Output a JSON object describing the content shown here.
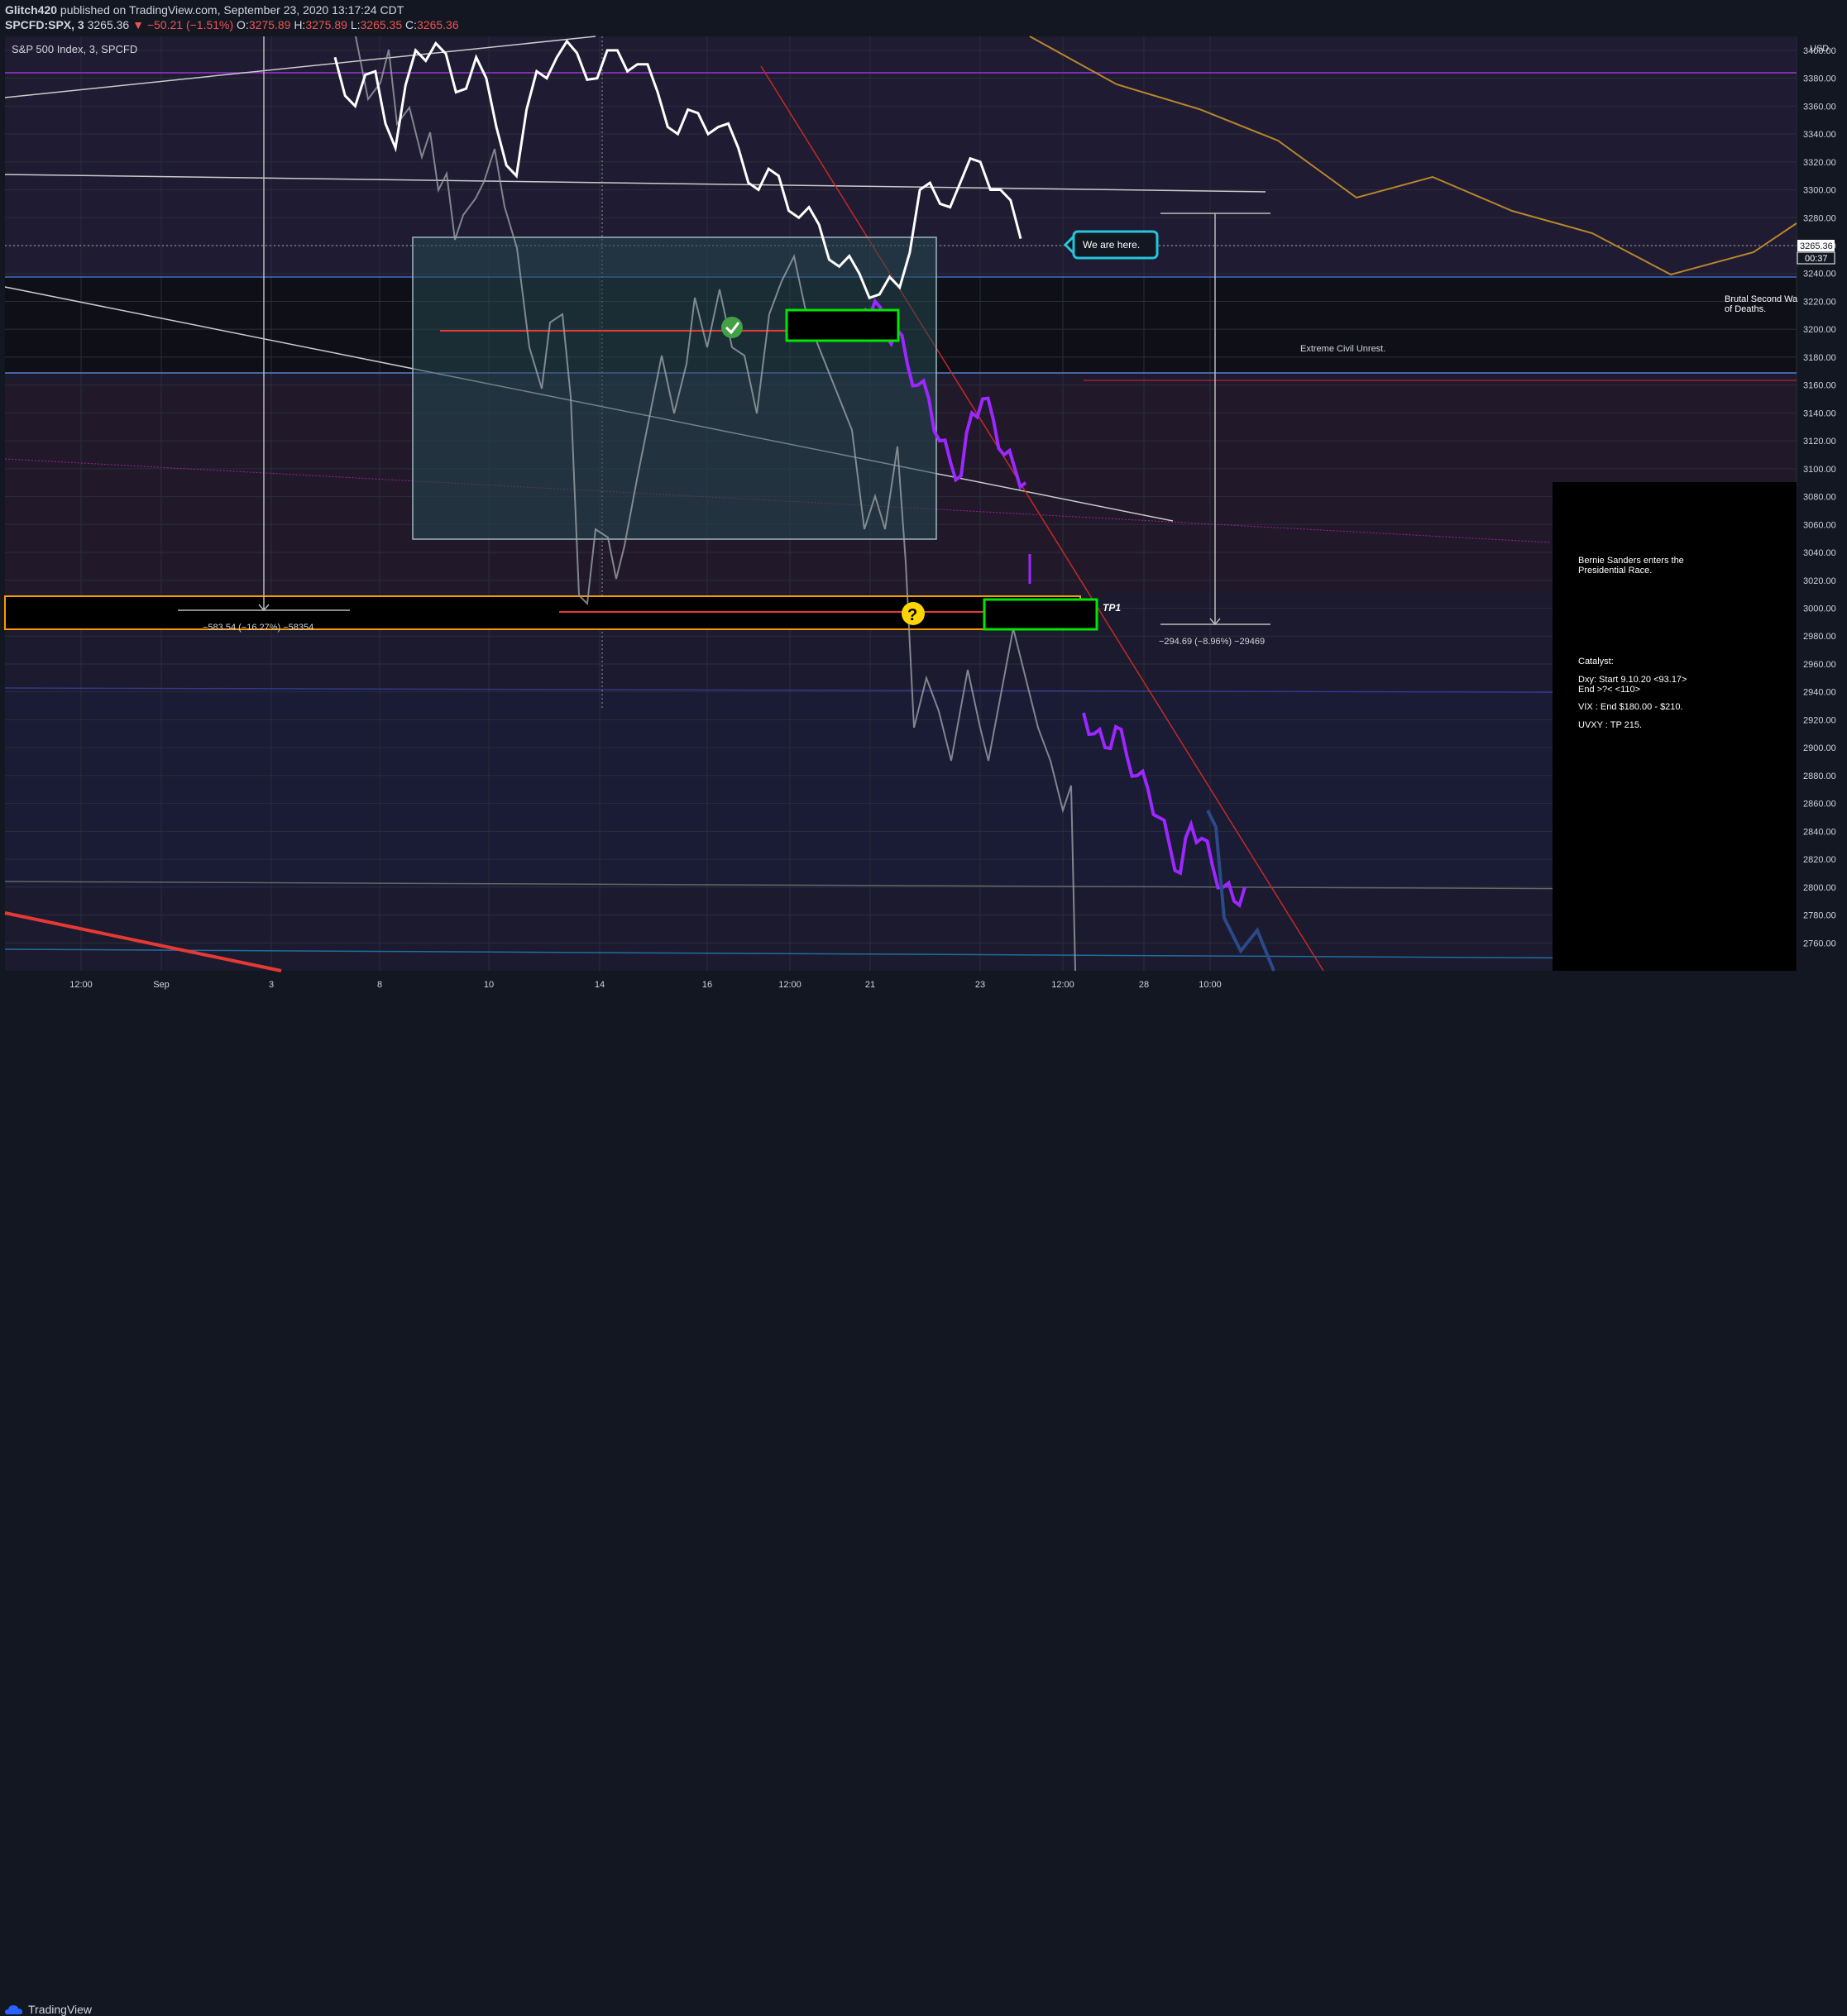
{
  "header": {
    "author": "Glitch420",
    "published": "published on TradingView.com, September 23, 2020 13:17:24 CDT",
    "symbol": "SPCFD:SPX, 3",
    "last": "3265.36",
    "change": "−50.21 (−1.51%)",
    "o_label": "O:",
    "o": "3275.89",
    "h_label": "H:",
    "h": "3275.89",
    "l_label": "L:",
    "l": "3265.35",
    "c_label": "C:",
    "c": "3265.36"
  },
  "pane": {
    "title": "S&P 500 Index, 3, SPCFD",
    "currency": "USD",
    "price_tag": "3265.36",
    "time_tag": "00:37"
  },
  "annotations": {
    "we_are_here": "We are here.",
    "brutal": "Brutal Second Wave of Deaths.",
    "civil_unrest": "Extreme Civil Unrest.",
    "measure_left": "−583.54 (−16.27%) −58354",
    "measure_right": "−294.69 (−8.96%) −29469",
    "tp1": "TP1",
    "question": "?",
    "note_bernie": "Bernie Sanders enters the Presidential Race.",
    "note_catalyst": "Catalyst:",
    "note_dxy": "Dxy: Start 9.10.20 <93.17> End >?< <110>",
    "note_vix": "VIX : End $180.00 - $210.",
    "note_uvxy": "UVXY : TP 215."
  },
  "footer": {
    "brand": "TradingView"
  },
  "colors": {
    "background": "#131722",
    "price_line": "#ffffff",
    "projection": "#9c27ff",
    "trendline": "#c62828",
    "box_fill": "#1f3a45",
    "target_border": "#00e600",
    "zone_border": "#ff9800",
    "gold_line": "#b8862b"
  },
  "chart_data": {
    "type": "line",
    "title": "S&P 500 Index, 3, SPCFD",
    "ylim": [
      2740,
      3410
    ],
    "y_ticks": [
      2760,
      2780,
      2800,
      2820,
      2840,
      2860,
      2880,
      2900,
      2920,
      2940,
      2960,
      2980,
      3000,
      3020,
      3040,
      3060,
      3080,
      3100,
      3120,
      3140,
      3160,
      3180,
      3200,
      3220,
      3240,
      3260,
      3280,
      3300,
      3320,
      3340,
      3360,
      3380,
      3400
    ],
    "x_tick_labels": [
      "12:00",
      "Sep",
      "3",
      "8",
      "10",
      "14",
      "16",
      "12:00",
      "21",
      "23",
      "12:00",
      "28",
      "10:00"
    ],
    "series": [
      {
        "values": [
          3395,
          3360,
          3385,
          3330,
          3400,
          3405,
          3370,
          3395,
          3345,
          3310,
          3385,
          3395,
          3398,
          3380,
          3400,
          3390,
          3370,
          3340,
          3355,
          3345,
          3330,
          3300,
          3310,
          3280,
          3275,
          3245,
          3240,
          3225,
          3230,
          3300,
          3290,
          3305,
          3320,
          3300,
          3265
        ]
      },
      {
        "values": [
          3215,
          3220,
          3195,
          3200,
          3175,
          3160,
          3150,
          3120,
          3105,
          3095,
          3140,
          3150,
          3135,
          3110,
          3100,
          3090
        ]
      },
      {
        "values": [
          2925,
          2910,
          2900,
          2915,
          2895,
          2880,
          2870,
          2850,
          2830,
          2810,
          2845,
          2835,
          2815,
          2800,
          2790,
          2800
        ]
      }
    ],
    "grid": true,
    "last_price": 3265.36
  }
}
